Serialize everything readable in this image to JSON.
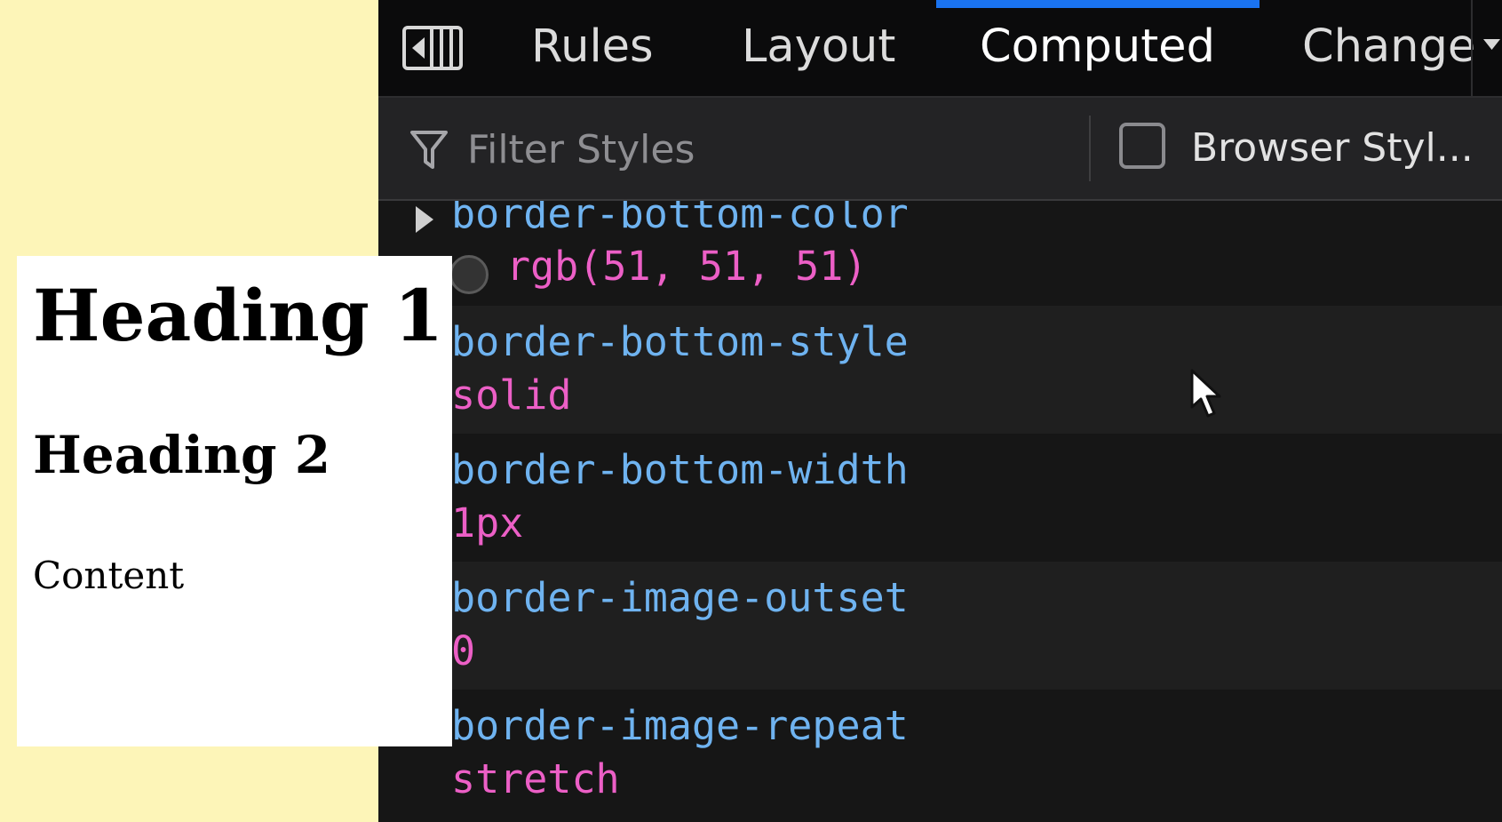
{
  "devtools": {
    "tabs": [
      {
        "label": "Rules",
        "active": false
      },
      {
        "label": "Layout",
        "active": false
      },
      {
        "label": "Computed",
        "active": true
      },
      {
        "label": "Change",
        "active": false
      }
    ],
    "filter": {
      "placeholder": "Filter Styles",
      "value": ""
    },
    "browser_styles": {
      "label": "Browser Styl...",
      "checked": false
    },
    "properties": [
      {
        "name": "border-bottom-color",
        "value": "rgb(51, 51, 51)",
        "swatch": "#333333",
        "expandable": true
      },
      {
        "name": "border-bottom-style",
        "value": "solid"
      },
      {
        "name": "border-bottom-width",
        "value": "1px"
      },
      {
        "name": "border-image-outset",
        "value": "0"
      },
      {
        "name": "border-image-repeat",
        "value": "stretch"
      }
    ]
  },
  "preview": {
    "heading1": "Heading 1",
    "heading2": "Heading 2",
    "content": "Content"
  },
  "colors": {
    "page_background": "#fdf5b8",
    "active_tab_indicator": "#1a73f0",
    "property_name": "#6fb3f0",
    "property_value": "#ec5fc6"
  }
}
